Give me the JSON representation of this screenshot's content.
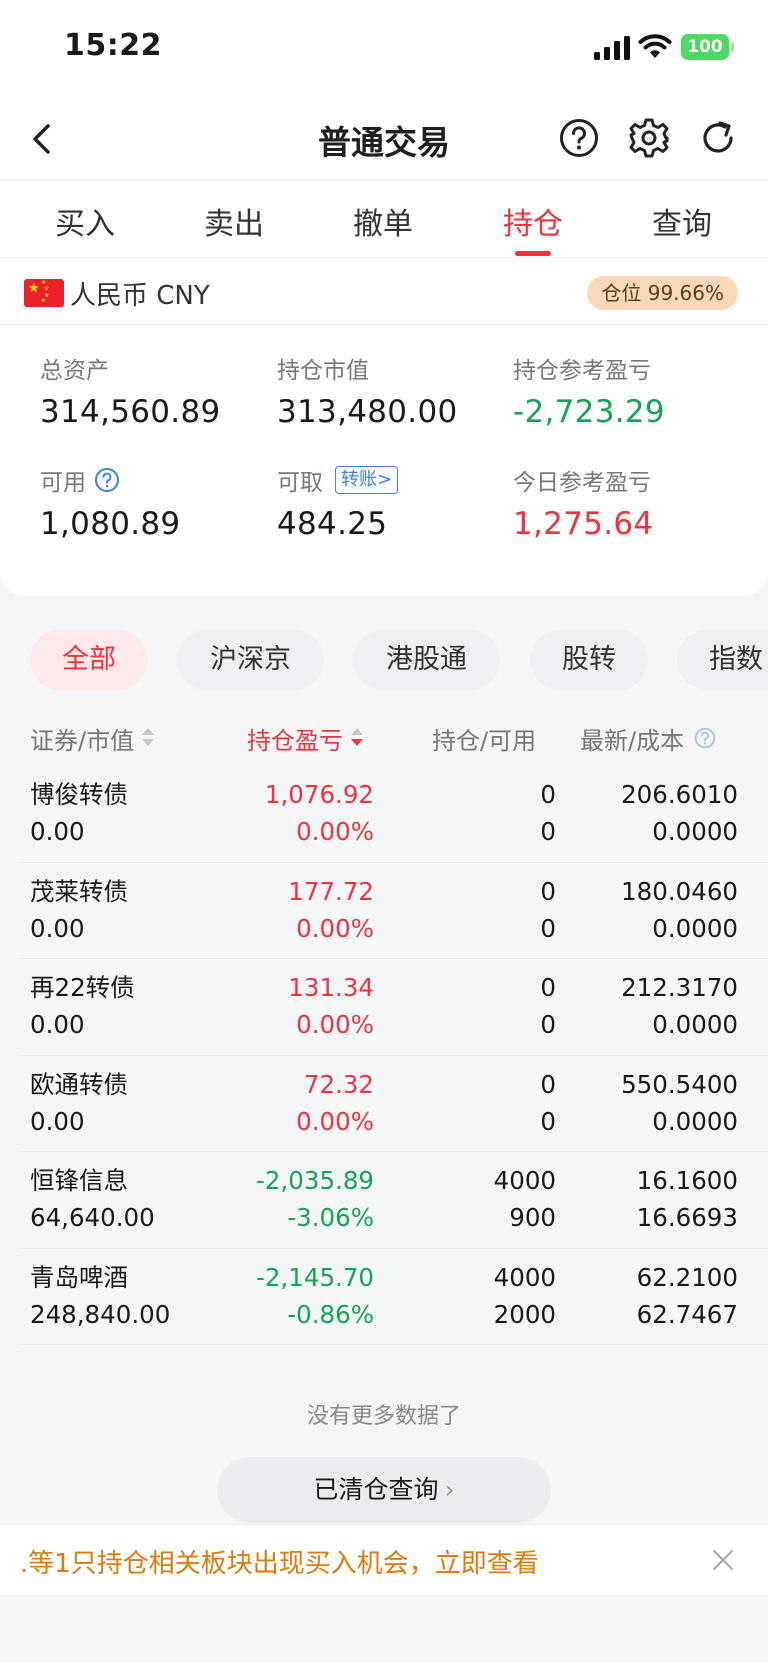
{
  "status_bar": {
    "time": "15:22",
    "battery": "100"
  },
  "nav": {
    "title": "普通交易"
  },
  "tabs": [
    {
      "label": "买入"
    },
    {
      "label": "卖出"
    },
    {
      "label": "撤单"
    },
    {
      "label": "持仓",
      "active": true
    },
    {
      "label": "查询"
    }
  ],
  "account": {
    "currency": "人民币 CNY",
    "position_ratio": "仓位 99.66%",
    "total_assets_label": "总资产",
    "total_assets": "314,560.89",
    "market_value_label": "持仓市值",
    "market_value": "313,480.00",
    "holding_pl_label": "持仓参考盈亏",
    "holding_pl": "-2,723.29",
    "available_label": "可用",
    "available": "1,080.89",
    "withdrawable_label": "可取",
    "withdrawable": "484.25",
    "transfer_label": "转账>",
    "today_pl_label": "今日参考盈亏",
    "today_pl": "1,275.64"
  },
  "filters": [
    {
      "label": "全部",
      "active": true
    },
    {
      "label": "沪深京"
    },
    {
      "label": "港股通"
    },
    {
      "label": "股转"
    },
    {
      "label": "指数"
    }
  ],
  "table": {
    "headers": {
      "security": "证券/市值",
      "pl": "持仓盈亏",
      "position": "持仓/可用",
      "price": "最新/成本"
    },
    "rows": [
      {
        "name": "博俊转债",
        "market_value": "0.00",
        "pl": "1,076.92",
        "pl_pct": "0.00%",
        "position": "0",
        "available": "0",
        "last": "206.6010",
        "cost": "0.0000",
        "dir": "pos"
      },
      {
        "name": "茂莱转债",
        "market_value": "0.00",
        "pl": "177.72",
        "pl_pct": "0.00%",
        "position": "0",
        "available": "0",
        "last": "180.0460",
        "cost": "0.0000",
        "dir": "pos"
      },
      {
        "name": "再22转债",
        "market_value": "0.00",
        "pl": "131.34",
        "pl_pct": "0.00%",
        "position": "0",
        "available": "0",
        "last": "212.3170",
        "cost": "0.0000",
        "dir": "pos"
      },
      {
        "name": "欧通转债",
        "market_value": "0.00",
        "pl": "72.32",
        "pl_pct": "0.00%",
        "position": "0",
        "available": "0",
        "last": "550.5400",
        "cost": "0.0000",
        "dir": "pos"
      },
      {
        "name": "恒锋信息",
        "market_value": "64,640.00",
        "pl": "-2,035.89",
        "pl_pct": "-3.06%",
        "position": "4000",
        "available": "900",
        "last": "16.1600",
        "cost": "16.6693",
        "dir": "neg"
      },
      {
        "name": "青岛啤酒",
        "market_value": "248,840.00",
        "pl": "-2,145.70",
        "pl_pct": "-0.86%",
        "position": "4000",
        "available": "2000",
        "last": "62.2100",
        "cost": "62.7467",
        "dir": "neg"
      }
    ]
  },
  "footer": {
    "no_more": "没有更多数据了",
    "cleared_button": "已清仓查询",
    "banner_text": ".等1只持仓相关板块出现买入机会，立即查看"
  },
  "colors": {
    "accent_red": "#f0323c",
    "down_green": "#14a552",
    "link_blue": "#3a7ff1",
    "banner_orange": "#e07a0a"
  }
}
